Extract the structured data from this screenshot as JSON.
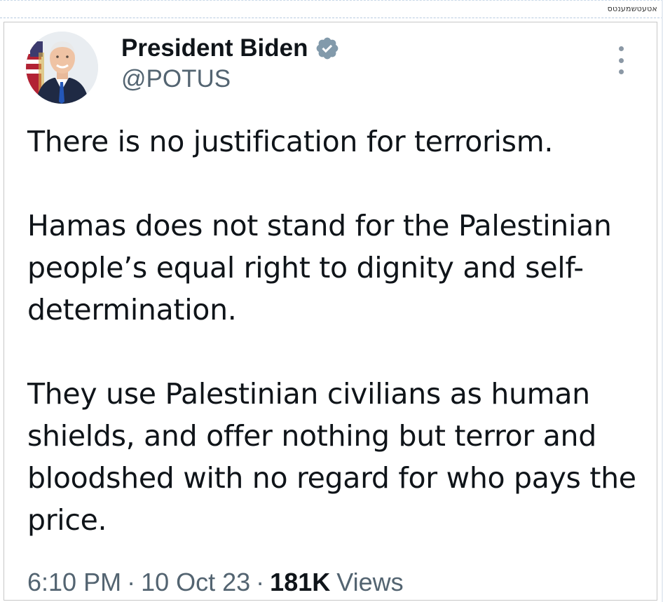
{
  "watermark": "אטעטשמענטס",
  "author": {
    "name": "President Biden",
    "handle": "@POTUS",
    "avatar_icon": "portrait-avatar",
    "verified_icon": "verified-badge-icon",
    "verified_color": "#829aab"
  },
  "more_icon": "more-options-icon",
  "tweet": {
    "paragraphs": [
      "There is no justification for terrorism.",
      "Hamas does not stand for the Palestinian people’s equal right to dignity and self-determination.",
      "They use Palestinian civilians as human shields, and offer nothing but terror and bloodshed with no regard for who pays the price."
    ]
  },
  "meta": {
    "time": "6:10 PM",
    "separator": "·",
    "date": "10 Oct 23",
    "views_count": "181K",
    "views_label": "Views"
  },
  "colors": {
    "text": "#0f1419",
    "secondary": "#536471",
    "border": "#c7c7c7"
  }
}
